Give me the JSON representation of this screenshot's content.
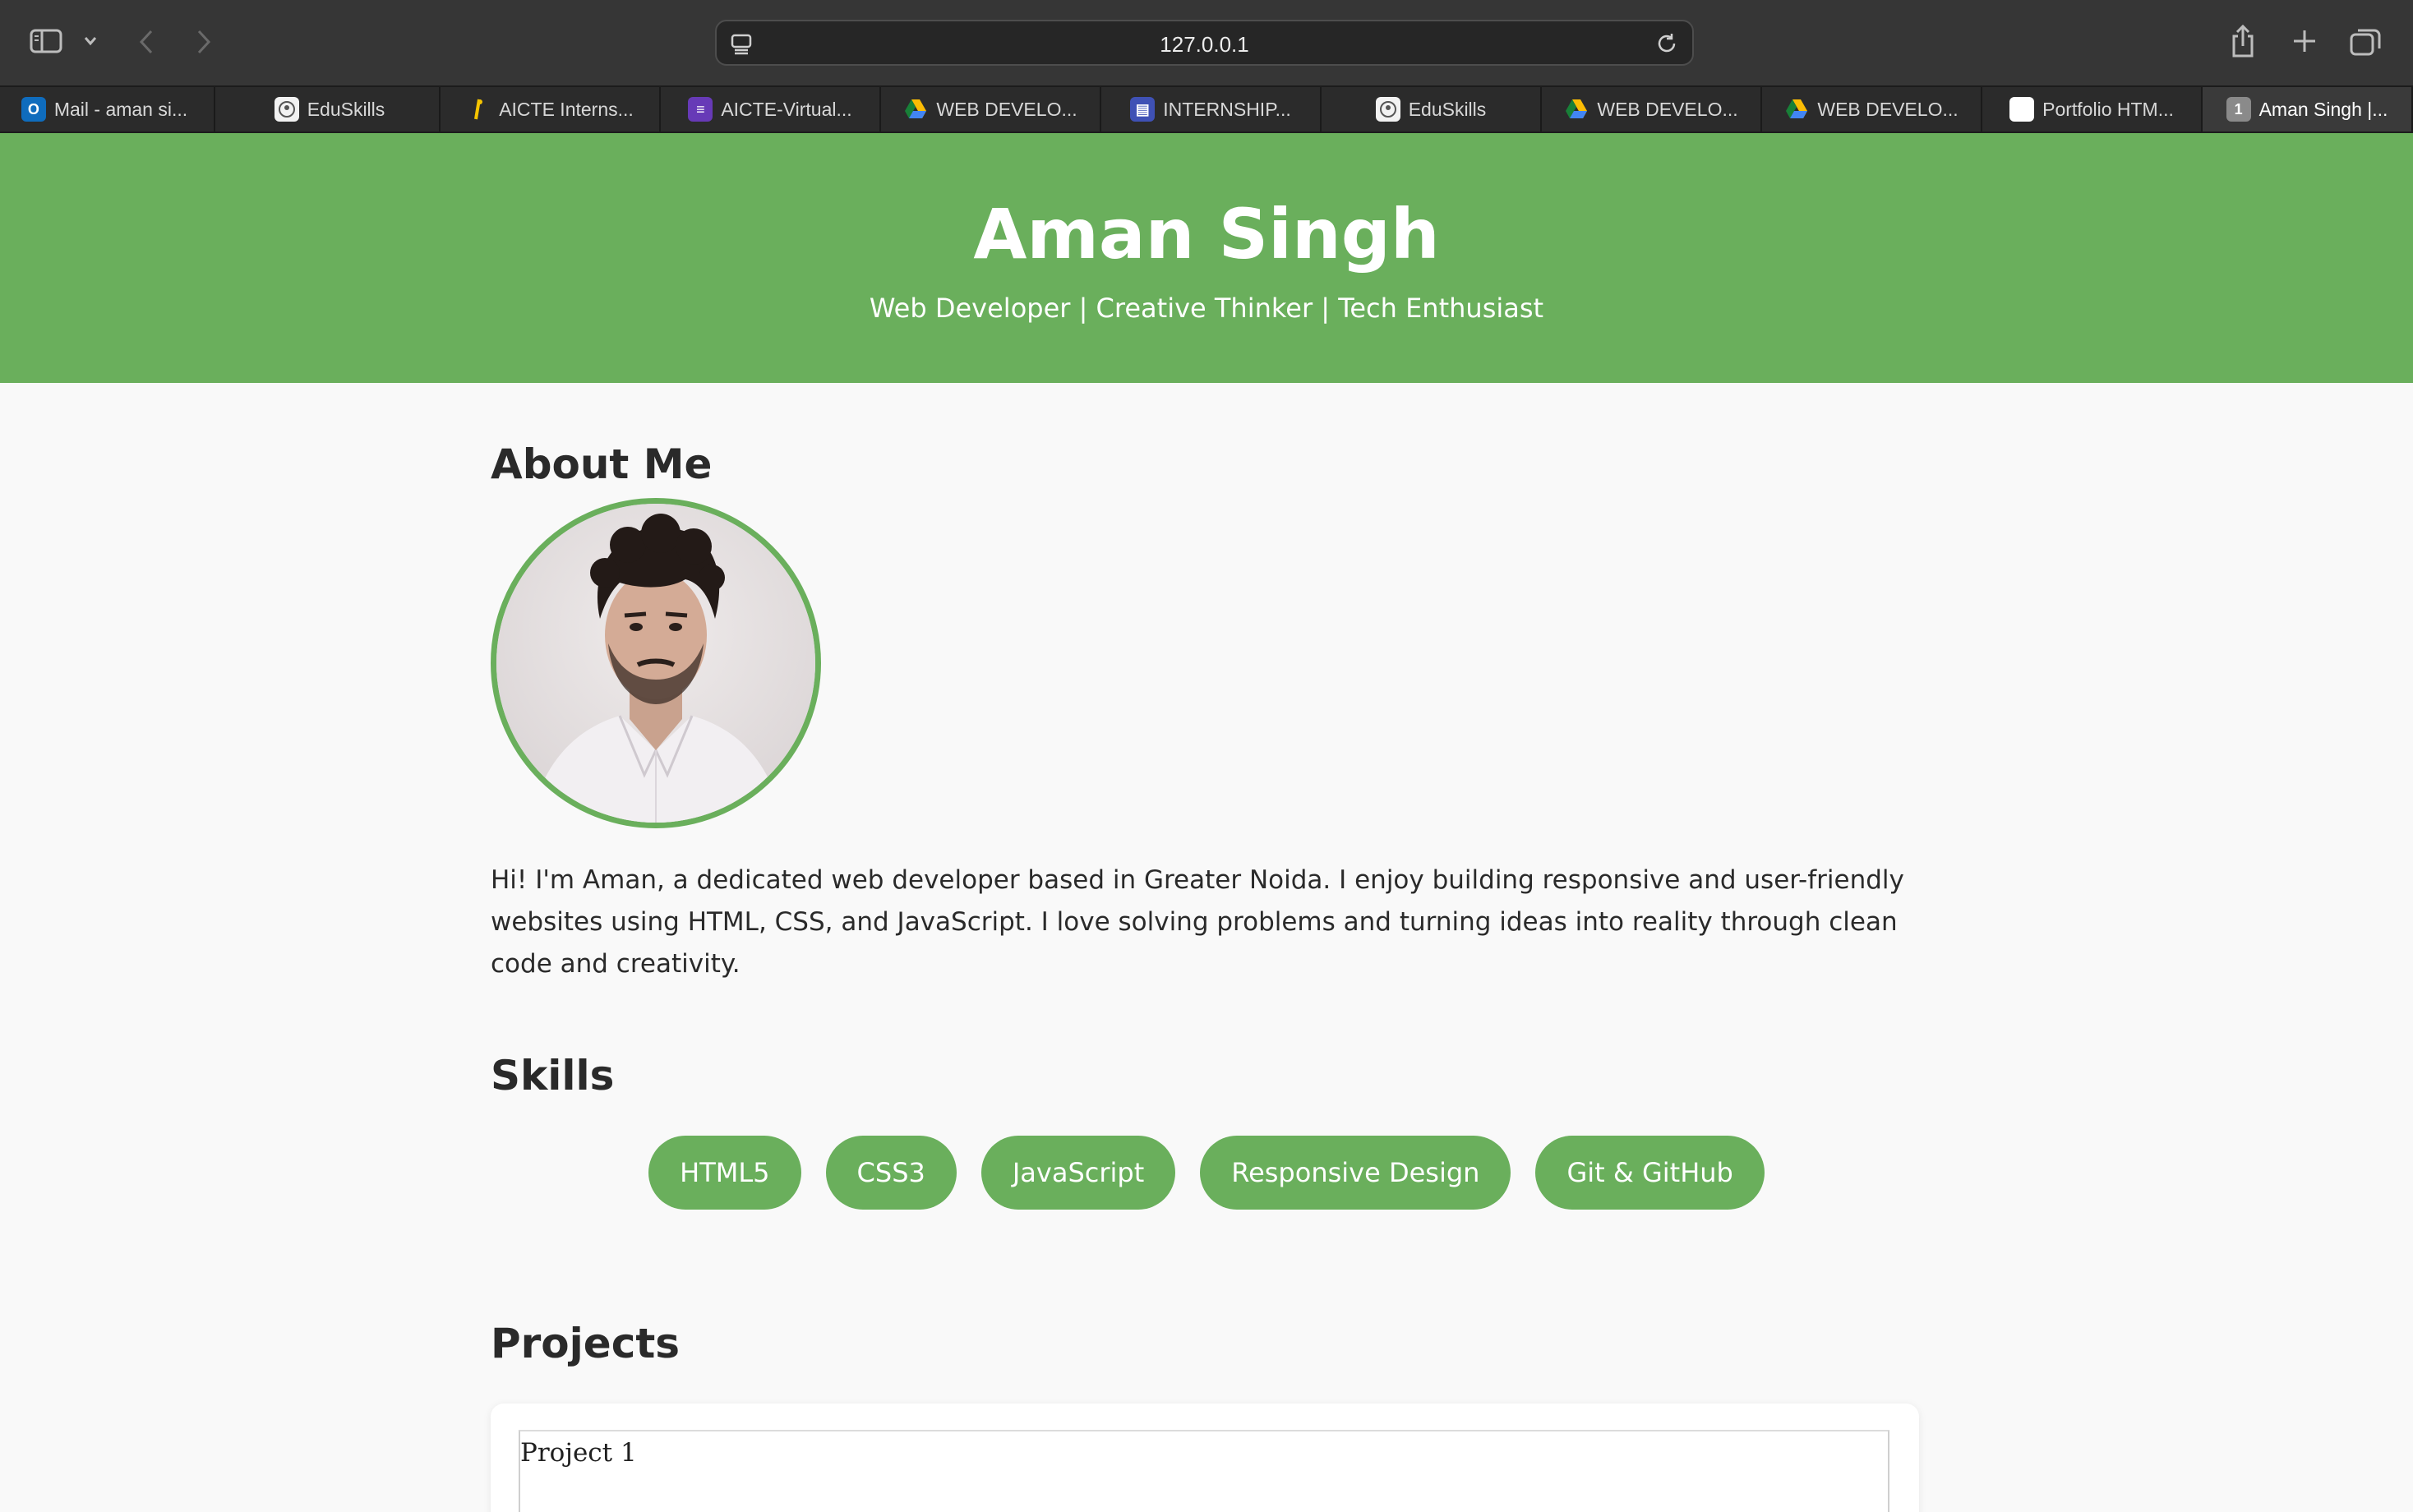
{
  "browser": {
    "url": "127.0.0.1",
    "tabs": [
      {
        "label": "Mail - aman si...",
        "icon": "outlook-icon",
        "color": "#0f6cbd",
        "glyph": "O"
      },
      {
        "label": "EduSkills",
        "icon": "eduskills-icon",
        "color": "#f2f2f2",
        "glyph": ""
      },
      {
        "label": "AICTE Interns...",
        "icon": "aicte-icon",
        "color": "#2b2b2b",
        "glyph": ""
      },
      {
        "label": "AICTE-Virtual...",
        "icon": "forms-icon",
        "color": "#673ab7",
        "glyph": "≡"
      },
      {
        "label": "WEB DEVELO...",
        "icon": "drive-icon",
        "color": "#2b2b2b",
        "glyph": ""
      },
      {
        "label": "INTERNSHIP...",
        "icon": "sites-icon",
        "color": "#3f51b5",
        "glyph": "▤"
      },
      {
        "label": "EduSkills",
        "icon": "eduskills-icon",
        "color": "#f2f2f2",
        "glyph": ""
      },
      {
        "label": "WEB DEVELO...",
        "icon": "drive-icon",
        "color": "#2b2b2b",
        "glyph": ""
      },
      {
        "label": "WEB DEVELO...",
        "icon": "drive-icon",
        "color": "#2b2b2b",
        "glyph": ""
      },
      {
        "label": "Portfolio HTM...",
        "icon": "chatgpt-icon",
        "color": "#ffffff",
        "glyph": "✿"
      },
      {
        "label": "Aman Singh |...",
        "icon": "tab-number-icon",
        "color": "#8a8a8a",
        "glyph": "1",
        "active": true
      }
    ]
  },
  "header": {
    "name": "Aman Singh",
    "tagline": "Web Developer | Creative Thinker | Tech Enthusiast"
  },
  "about": {
    "title": "About Me",
    "text": "Hi! I'm Aman, a dedicated web developer based in Greater Noida. I enjoy building responsive and user-friendly websites using HTML, CSS, and JavaScript. I love solving problems and turning ideas into reality through clean code and creativity."
  },
  "skills": {
    "title": "Skills",
    "items": [
      "HTML5",
      "CSS3",
      "JavaScript",
      "Responsive Design",
      "Git & GitHub"
    ]
  },
  "projects": {
    "title": "Projects",
    "items": [
      {
        "label": "Project 1"
      }
    ]
  },
  "colors": {
    "accent": "#6aaf5c",
    "background": "#f9f9f9",
    "text": "#2a2a2a"
  }
}
